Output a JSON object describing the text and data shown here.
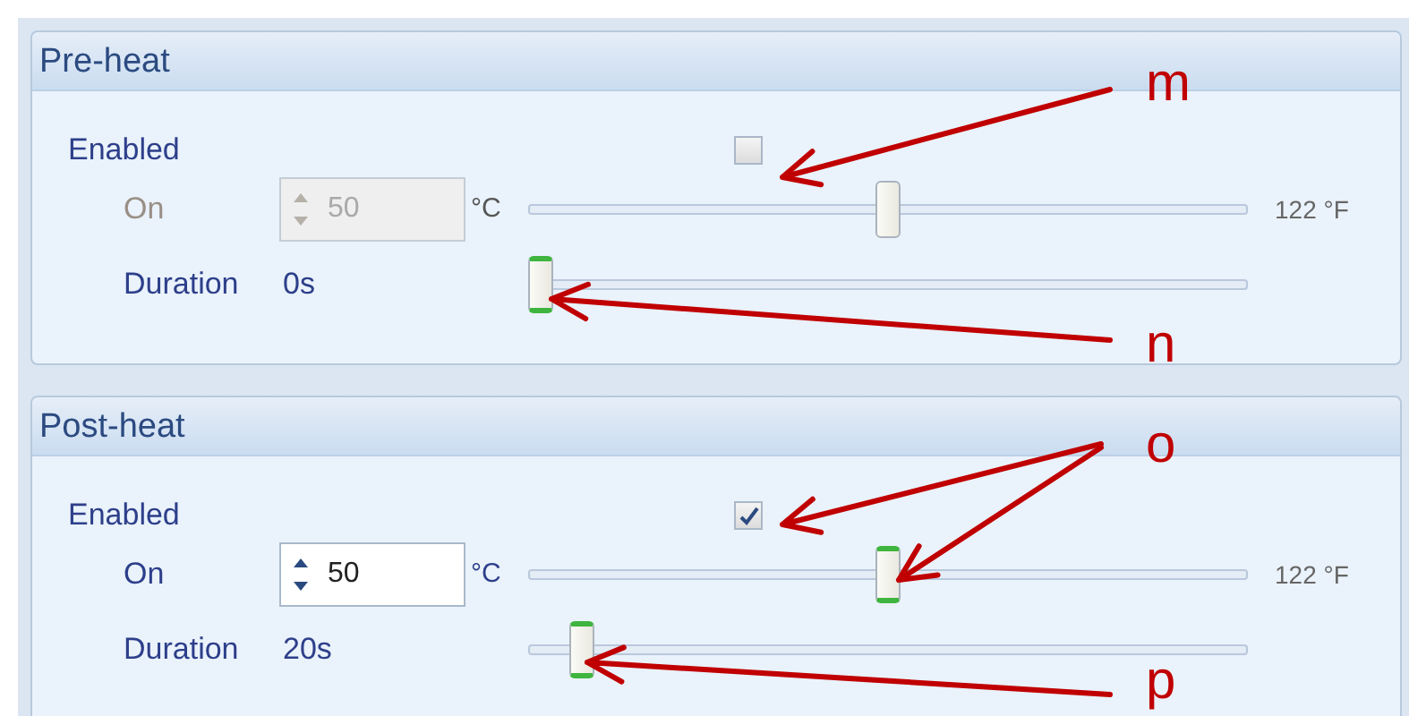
{
  "sections": [
    {
      "title": "Pre-heat",
      "enabled_label": "Enabled",
      "enabled": false,
      "on": {
        "label": "On",
        "value": "50",
        "unit": "°C",
        "level": 0.5,
        "reading": "122 °F",
        "disabled": true
      },
      "duration": {
        "label": "Duration",
        "value": "0s",
        "level": 0
      }
    },
    {
      "title": "Post-heat",
      "enabled_label": "Enabled",
      "enabled": true,
      "on": {
        "label": "On",
        "value": "50",
        "unit": "°C",
        "level": 0.5,
        "reading": "122 °F",
        "disabled": false
      },
      "duration": {
        "label": "Duration",
        "value": "20s",
        "level": 0.06
      }
    }
  ],
  "annotations": [
    {
      "label": "m"
    },
    {
      "label": "n"
    },
    {
      "label": "o"
    },
    {
      "label": "p"
    }
  ]
}
